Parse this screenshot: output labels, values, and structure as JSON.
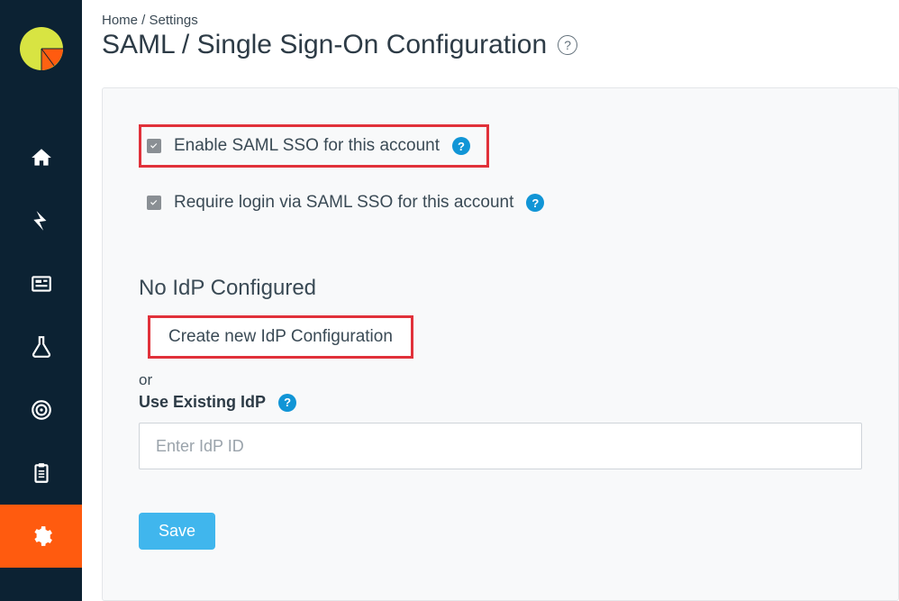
{
  "breadcrumb": {
    "home": "Home",
    "sep": " / ",
    "settings": "Settings"
  },
  "page_title": "SAML / Single Sign-On Configuration",
  "options": {
    "enable_label": "Enable SAML SSO for this account",
    "enable_checked": true,
    "require_label": "Require login via SAML SSO for this account",
    "require_checked": true
  },
  "idp": {
    "heading": "No IdP Configured",
    "create_button": "Create new IdP Configuration",
    "or": "or",
    "existing_label": "Use Existing IdP",
    "input_placeholder": "Enter IdP ID"
  },
  "save_label": "Save",
  "sidebar": {
    "items": [
      {
        "name": "home"
      },
      {
        "name": "activity"
      },
      {
        "name": "news"
      },
      {
        "name": "labs"
      },
      {
        "name": "target"
      },
      {
        "name": "clipboard"
      },
      {
        "name": "settings",
        "active": true
      }
    ]
  },
  "colors": {
    "accent": "#ff5b0f",
    "sidebar": "#0c2233",
    "blue": "#40b6ed",
    "highlight": "#e1313a"
  }
}
